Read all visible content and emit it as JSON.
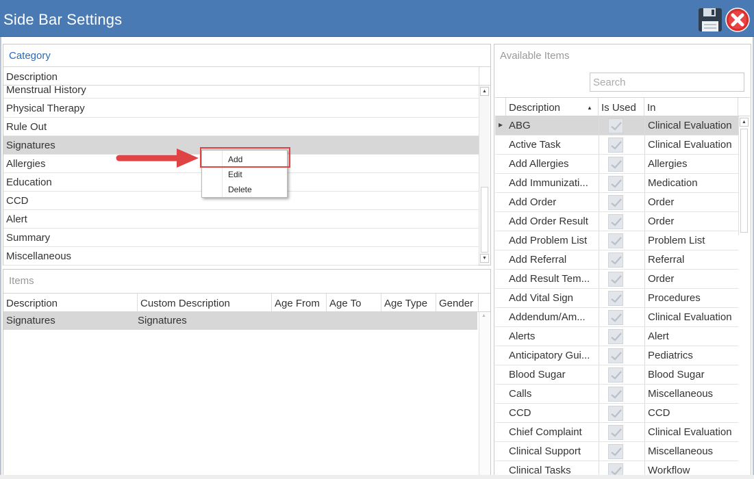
{
  "window": {
    "title": "Side Bar Settings"
  },
  "category": {
    "title": "Category",
    "header": "Description",
    "rows": [
      "Menstrual History",
      "Physical Therapy",
      "Rule Out",
      "Signatures",
      "Allergies",
      "Education",
      "CCD",
      "Alert",
      "Summary",
      "Miscellaneous"
    ],
    "selected": "Signatures"
  },
  "context_menu": {
    "items": [
      "Add",
      "Edit",
      "Delete"
    ],
    "highlighted": "Add",
    "accent": "#e04343"
  },
  "items": {
    "title": "Items",
    "headers": [
      "Description",
      "Custom Description",
      "Age From",
      "Age To",
      "Age Type",
      "Gender"
    ],
    "rows": [
      {
        "description": "Signatures",
        "custom_description": "Signatures"
      }
    ]
  },
  "available": {
    "title": "Available Items",
    "search_placeholder": "Search",
    "headers": {
      "description": "Description",
      "is_used": "Is Used",
      "in": "In"
    },
    "sort_icon": "sort-ascending-icon",
    "rows": [
      {
        "description": "ABG",
        "in": "Clinical Evaluation",
        "used": true
      },
      {
        "description": "Active Task",
        "in": "Clinical Evaluation",
        "used": true
      },
      {
        "description": "Add Allergies",
        "in": "Allergies",
        "used": true
      },
      {
        "description": "Add Immunizati...",
        "in": "Medication",
        "used": true
      },
      {
        "description": "Add Order",
        "in": "Order",
        "used": true
      },
      {
        "description": "Add Order Result",
        "in": "Order",
        "used": true
      },
      {
        "description": "Add Problem List",
        "in": "Problem List",
        "used": true
      },
      {
        "description": "Add Referral",
        "in": "Referral",
        "used": true
      },
      {
        "description": "Add Result Tem...",
        "in": "Order",
        "used": true
      },
      {
        "description": "Add Vital Sign",
        "in": "Procedures",
        "used": true
      },
      {
        "description": "Addendum/Am...",
        "in": "Clinical Evaluation",
        "used": true
      },
      {
        "description": "Alerts",
        "in": "Alert",
        "used": true
      },
      {
        "description": "Anticipatory Gui...",
        "in": "Pediatrics",
        "used": true
      },
      {
        "description": "Blood Sugar",
        "in": "Blood Sugar",
        "used": true
      },
      {
        "description": "Calls",
        "in": "Miscellaneous",
        "used": true
      },
      {
        "description": "CCD",
        "in": "CCD",
        "used": true
      },
      {
        "description": "Chief Complaint",
        "in": "Clinical Evaluation",
        "used": true
      },
      {
        "description": "Clinical Support",
        "in": "Miscellaneous",
        "used": true
      },
      {
        "description": "Clinical Tasks",
        "in": "Workflow",
        "used": true
      }
    ]
  },
  "colors": {
    "titlebar": "#4a7ab4",
    "selected_row": "#d7d7d7",
    "category_title": "#2a6ab8"
  },
  "icons": {
    "save": "floppy-disk-icon",
    "close": "close-circle-icon",
    "row_indicator": "current-row-indicator-icon",
    "checkbox": "checkmark-icon"
  }
}
